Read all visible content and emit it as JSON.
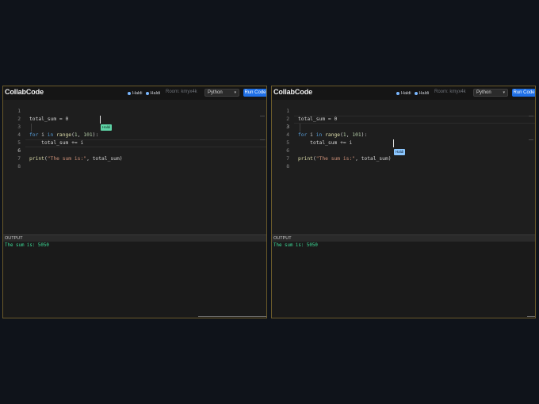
{
  "panes": [
    {
      "app_title": "CollabCode",
      "users": [
        "Haldi",
        "Haldi"
      ],
      "room": "Room: kmyx4k",
      "language": "Python",
      "run_label": "Run Code",
      "code_lines": [
        {
          "n": "1",
          "text": "total_sum = 0"
        },
        {
          "n": "2",
          "text": ""
        },
        {
          "n": "3",
          "text": "for i in range(1, 101):"
        },
        {
          "n": "4",
          "text": "    total_sum += i"
        },
        {
          "n": "5",
          "text": ""
        },
        {
          "n": "6",
          "text": "print(\"The sum is:\", total_sum)"
        },
        {
          "n": "7",
          "text": ""
        },
        {
          "n": "8",
          "text": ""
        }
      ],
      "cursor_label": "Haldi",
      "output_label": "OUTPUT",
      "output_text": "The sum is: 5050"
    },
    {
      "app_title": "CollabCode",
      "users": [
        "Haldi",
        "Haldi"
      ],
      "room": "Room: kmyx4k",
      "language": "Python",
      "run_label": "Run Code",
      "code_lines": [
        {
          "n": "1",
          "text": "total_sum = 0"
        },
        {
          "n": "2",
          "text": ""
        },
        {
          "n": "3",
          "text": "for i in range(1, 101):"
        },
        {
          "n": "4",
          "text": "    total_sum += i"
        },
        {
          "n": "5",
          "text": ""
        },
        {
          "n": "6",
          "text": "print(\"The sum is:\", total_sum)"
        },
        {
          "n": "7",
          "text": ""
        },
        {
          "n": "8",
          "text": ""
        }
      ],
      "cursor_label": "Haldi",
      "output_label": "OUTPUT",
      "output_text": "The sum is: 5050"
    }
  ],
  "colors": {
    "keyword": "#569cd6",
    "function": "#dcdcaa",
    "number": "#b5cea8",
    "string": "#ce9178",
    "output": "#3ddc97",
    "run_button": "#1f6fe5",
    "cursor_tag_left": "#5ed3a6",
    "cursor_tag_right": "#8cc7ff"
  }
}
